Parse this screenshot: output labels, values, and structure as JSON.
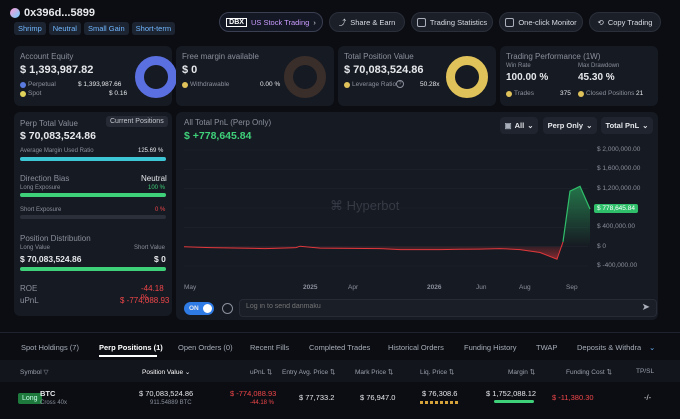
{
  "account": {
    "address": "0x396d...5899",
    "tags": [
      "Shrimp",
      "Neutral",
      "Small Gain",
      "Short-term"
    ]
  },
  "nav": {
    "us_stock": "US Stock Trading",
    "share": "Share & Earn",
    "stats": "Trading Statistics",
    "monitor": "One-click Monitor",
    "copy": "Copy Trading"
  },
  "equity": {
    "label": "Account Equity",
    "value": "$ 1,393,987.82",
    "perp_label": "Perpetual",
    "perp_value": "$ 1,393,987.66",
    "spot_label": "Spot",
    "spot_value": "$ 0.16"
  },
  "margin": {
    "label": "Free margin available",
    "value": "$ 0",
    "withdraw_label": "Withdrawable",
    "withdraw_value": "0.00 %"
  },
  "position": {
    "label": "Total Position Value",
    "value": "$ 70,083,524.86",
    "lev_label": "Leverage Ratio",
    "lev_value": "50.28x"
  },
  "perf": {
    "label": "Trading Performance (1W)",
    "win_label": "Win Rate",
    "win_value": "100.00 %",
    "dd_label": "Max Drawdown",
    "dd_value": "45.30 %",
    "trades_label": "Trades",
    "trades_value": "375",
    "closed_label": "Closed Positions",
    "closed_value": "21"
  },
  "perp": {
    "label": "Perp Total Value",
    "btn": "Current Positions",
    "value": "$ 70,083,524.86",
    "margin_label": "Average Margin Used Ratio",
    "margin_value": "125.69 %",
    "margin_fill": 1.0,
    "bias_label": "Direction Bias",
    "bias_value": "Neutral",
    "long_label": "Long Exposure",
    "long_value": "100 %",
    "long_fill": 1.0,
    "short_label": "Short Exposure",
    "short_value": "0 %",
    "short_fill": 0.0,
    "dist_label": "Position Distribution",
    "long_val_label": "Long Value",
    "short_val_label": "Short Value",
    "long_val": "$ 70,083,524.86",
    "short_val": "$ 0",
    "roe_label": "ROE",
    "roe_value": "-44.18 %",
    "upnl_label": "uPnL",
    "upnl_value": "$ -774,088.93"
  },
  "chart": {
    "title": "All Total PnL (Perp Only)",
    "value": "$ +778,645.84",
    "dd_all": "All",
    "dd_perp": "Perp Only",
    "dd_total": "Total PnL",
    "watermark": "Hyperbot",
    "current_label": "$ 778,645.84"
  },
  "chart_data": {
    "type": "line",
    "title": "All Total PnL (Perp Only)",
    "x": [
      "May",
      "2025",
      "Apr",
      "2026",
      "Jun",
      "Aug",
      "Sep"
    ],
    "yticks": [
      "$ 2,000,000.00",
      "$ 1,600,000.00",
      "$ 1,200,000.00",
      "$ 800,000.00",
      "$ 400,000.00",
      "$ 0",
      "$ -400,000.00"
    ],
    "ylim": [
      -400000,
      2000000
    ],
    "series": [
      {
        "values": [
          0,
          -20000,
          -30000,
          -40000,
          -25000,
          -20000,
          10000,
          -30000,
          -35000,
          -40000,
          -60000,
          -60000,
          -60000,
          -55000,
          -50000,
          -40000,
          -60000,
          -120000,
          -260000,
          100000,
          1150000,
          1250000,
          778645
        ]
      }
    ]
  },
  "danmaku": {
    "toggle": "ON",
    "placeholder": "Log in to send danmaku"
  },
  "tabs": [
    "Spot Holdings (7)",
    "Perp Positions (1)",
    "Open Orders (0)",
    "Recent Fills",
    "Completed Trades",
    "Historical Orders",
    "Funding History",
    "TWAP",
    "Deposits & Withdraw"
  ],
  "table": {
    "headers": [
      "Symbol",
      "Position Value",
      "uPnL",
      "Entry Avg. Price",
      "Mark Price",
      "Liq. Price",
      "Margin",
      "Funding Cost",
      "TP/SL"
    ],
    "row": {
      "side": "Long",
      "symbol": "BTC",
      "mode": "Cross 40x",
      "value": "$ 70,083,524.86",
      "size": "911.54889 BTC",
      "upnl": "$ -774,088.93",
      "roe": "-44.18 %",
      "entry": "$ 77,733.2",
      "mark": "$ 76,947.0",
      "liq": "$ 76,308.6",
      "margin": "$ 1,752,088.12",
      "funding": "$ -11,380.30",
      "tpsl": "-/-"
    }
  }
}
